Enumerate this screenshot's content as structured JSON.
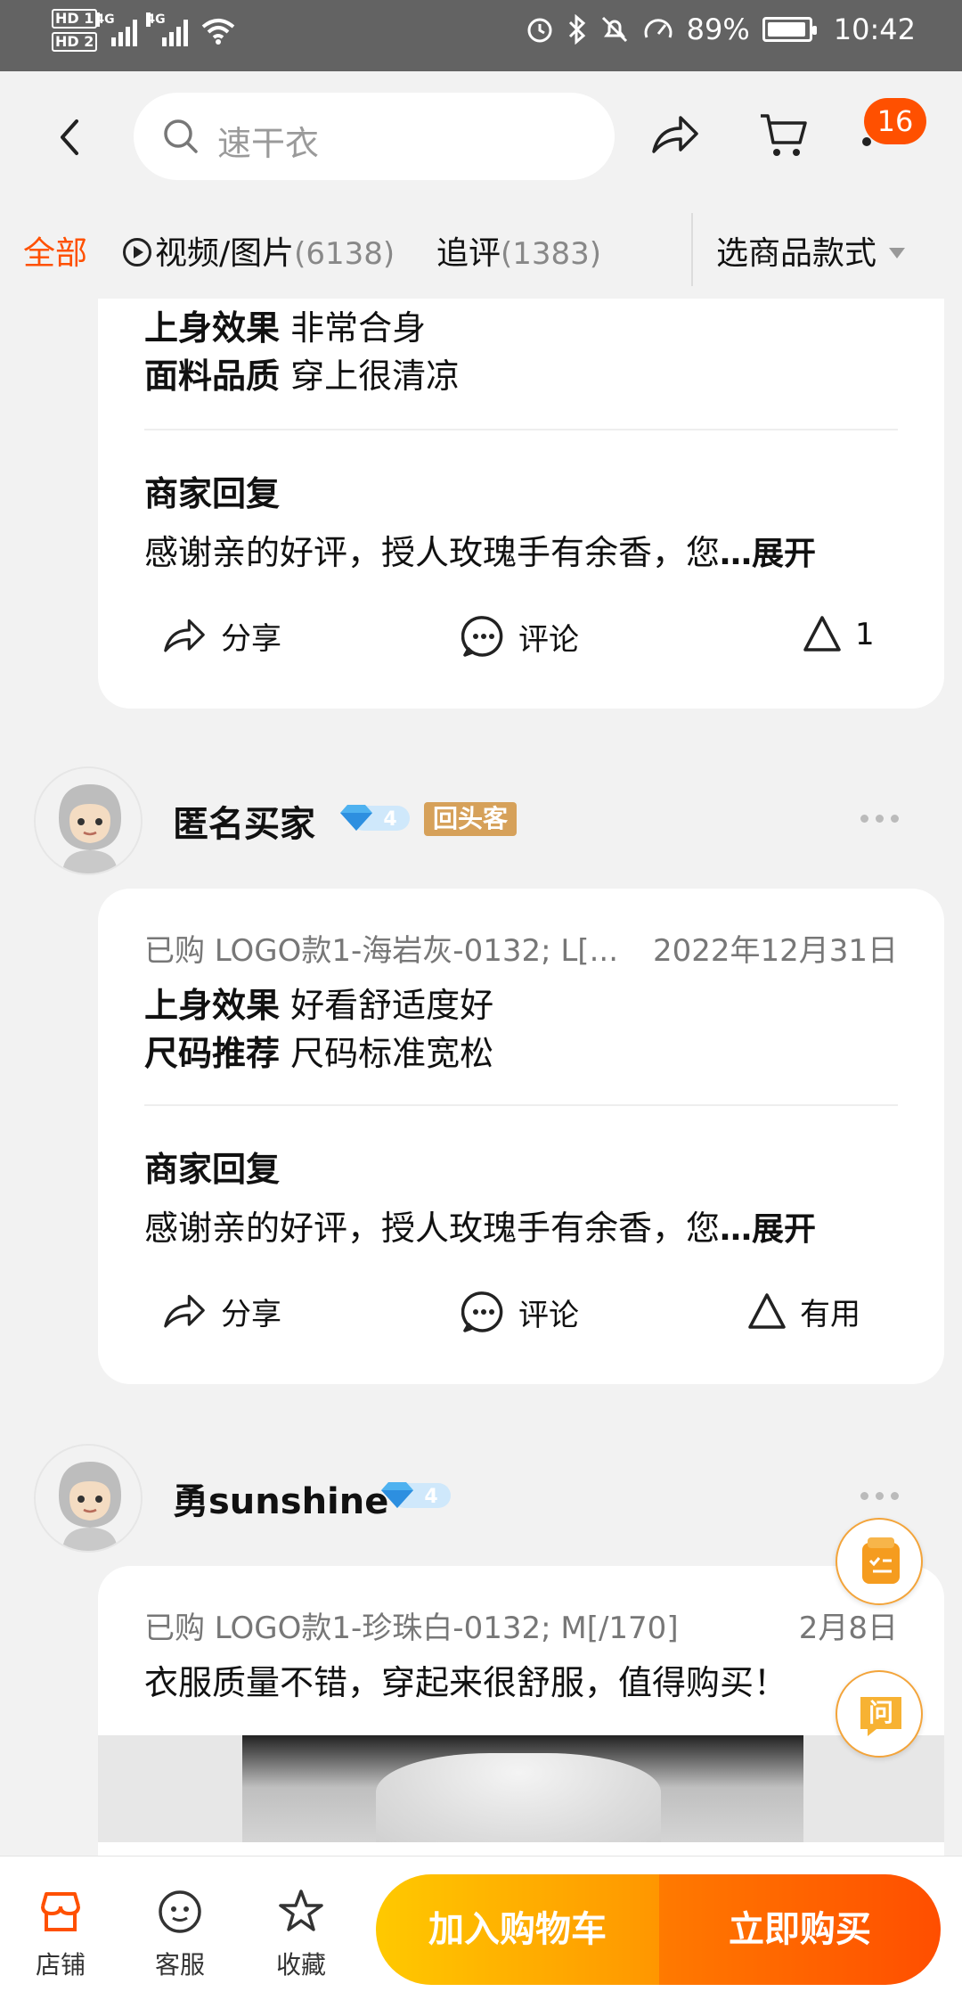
{
  "status_bar": {
    "hd1": "HD 1",
    "hd2": "HD 2",
    "net1": "4G",
    "net2": "4G",
    "battery": "89%",
    "time": "10:42",
    "icons": [
      "alarm-icon",
      "bluetooth-icon",
      "mute-icon",
      "speedometer-icon",
      "battery-icon"
    ]
  },
  "nav": {
    "search_placeholder": "速干衣",
    "cart_badge": "16",
    "icons": [
      "back-icon",
      "search-icon",
      "share-icon",
      "cart-icon"
    ]
  },
  "filters": {
    "all": "全部",
    "video_label": "视频/图片",
    "video_count": "(6138)",
    "followup_label": "追评",
    "followup_count": "(1383)",
    "style_select": "选商品款式"
  },
  "reviews": [
    {
      "lines": [
        {
          "key": "上身效果",
          "value": "非常合身"
        },
        {
          "key": "面料品质",
          "value": "穿上很清凉"
        }
      ],
      "reply_title": "商家回复",
      "reply_text": "感谢亲的好评，授人玫瑰手有余香，您",
      "reply_ellipsis": "…",
      "expand": "展开",
      "share": "分享",
      "comment": "评论",
      "useful": "1"
    },
    {
      "user": "匿名买家",
      "level": "4",
      "tag": "回头客",
      "purchased": "已购 LOGO款1-海岩灰-0132; L[...",
      "date": "2022年12月31日",
      "lines": [
        {
          "key": "上身效果",
          "value": "好看舒适度好"
        },
        {
          "key": "尺码推荐",
          "value": "尺码标准宽松"
        }
      ],
      "reply_title": "商家回复",
      "reply_text": "感谢亲的好评，授人玫瑰手有余香，您",
      "reply_ellipsis": "…",
      "expand": "展开",
      "share": "分享",
      "comment": "评论",
      "useful": "有用"
    },
    {
      "user": "勇sunshine",
      "level": "4",
      "purchased": "已购 LOGO款1-珍珠白-0132; M[/170]",
      "date": "2月8日",
      "text": "衣服质量不错，穿起来很舒服，值得购买！"
    }
  ],
  "floating": {
    "ask_label": "问"
  },
  "bottom": {
    "shop": "店铺",
    "service": "客服",
    "favorite": "收藏",
    "add_cart": "加入购物车",
    "buy_now": "立即购买"
  },
  "colors": {
    "accent": "#ff5000",
    "cart_gradient_start": "#ffc900",
    "buy_gradient_end": "#ff4e00"
  }
}
